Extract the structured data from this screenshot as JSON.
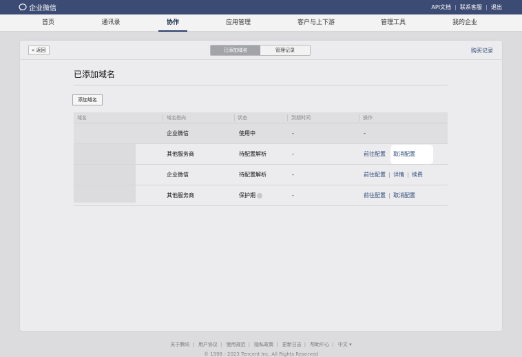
{
  "topbar": {
    "brand": "企业微信",
    "links": [
      "API文档",
      "联系客服",
      "退出"
    ]
  },
  "nav": {
    "items": [
      "首页",
      "通讯录",
      "协作",
      "应用管理",
      "客户与上下游",
      "管理工具",
      "我的企业"
    ],
    "active": "协作"
  },
  "card": {
    "back": "« 返回",
    "tabs": [
      "已添加域名",
      "管理记录"
    ],
    "buy_records": "购买记录",
    "title": "已添加域名",
    "add_button": "添加域名"
  },
  "table": {
    "headers": [
      "域名",
      "域名指向",
      "状态",
      "到期时间",
      "操作"
    ],
    "rows": [
      {
        "target": "企业微信",
        "status": "使用中",
        "expiry": "-",
        "actions": [
          "-"
        ]
      },
      {
        "target": "其他服务商",
        "status": "待配置解析",
        "expiry": "-",
        "actions": [
          "前往配置",
          "取消配置"
        ]
      },
      {
        "target": "企业微信",
        "status": "待配置解析",
        "expiry": "-",
        "actions": [
          "前往配置",
          "详情",
          "续费"
        ]
      },
      {
        "target": "其他服务商",
        "status": "保护期",
        "expiry": "-",
        "actions": [
          "前往配置",
          "取消配置"
        ]
      }
    ]
  },
  "footer": {
    "links": [
      "关于腾讯",
      "用户协议",
      "使用规范",
      "隐私政策",
      "更新日志",
      "帮助中心",
      "中文 ▾"
    ],
    "copyright": "© 1998 - 2023 Tencent Inc. All Rights Reserved"
  },
  "colors": {
    "topbar": "#3c4b73",
    "link": "#2d4a7a"
  }
}
